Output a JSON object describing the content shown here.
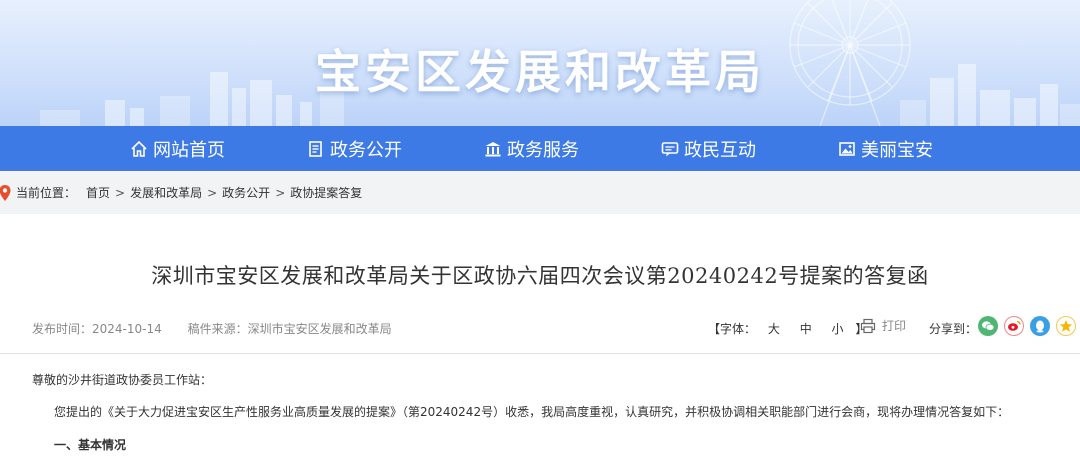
{
  "header": {
    "site_title": "宝安区发展和改革局"
  },
  "nav": {
    "items": [
      {
        "label": "网站首页",
        "icon": "home-icon"
      },
      {
        "label": "政务公开",
        "icon": "document-icon"
      },
      {
        "label": "政务服务",
        "icon": "bank-icon"
      },
      {
        "label": "政民互动",
        "icon": "chat-icon"
      },
      {
        "label": "美丽宝安",
        "icon": "picture-icon"
      }
    ]
  },
  "breadcrumb": {
    "label": "当前位置：",
    "items": [
      "首页",
      "发展和改革局",
      "政务公开",
      "政协提案答复"
    ],
    "separator": ">"
  },
  "article": {
    "title": "深圳市宝安区发展和改革局关于区政协六届四次会议第20240242号提案的答复函",
    "publish_time": "发布时间：2024-10-14",
    "source": "稿件来源：深圳市宝安区发展和改革局",
    "font_size": {
      "open": "【字体：",
      "large": "大",
      "medium": "中",
      "small": "小",
      "close": "】"
    },
    "print_label": "打印",
    "share_label": "分享到：",
    "share_icons": [
      "wechat-icon",
      "weibo-icon",
      "qq-icon",
      "qzone-icon"
    ],
    "greeting": "尊敬的沙井街道政协委员工作站：",
    "paragraph1": "您提出的《关于大力促进宝安区生产性服务业高质量发展的提案》（第20240242号）收悉，我局高度重视，认真研究，并积极协调相关职能部门进行会商，现将办理情况答复如下：",
    "section1": "一、基本情况"
  },
  "colors": {
    "nav_bg": "#3d7ae5",
    "crumb_bg": "#f2f3f5",
    "wechat": "#50b674",
    "weibo": "#e6162d",
    "qq": "#3aa0e6",
    "qzone": "#f7b700"
  }
}
